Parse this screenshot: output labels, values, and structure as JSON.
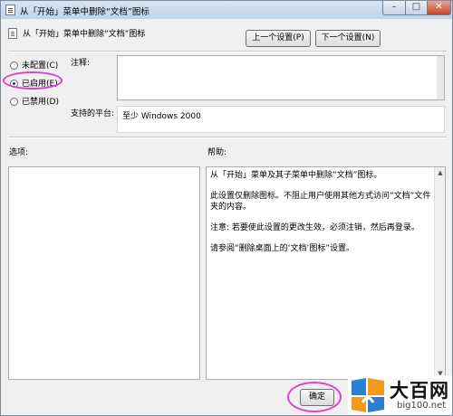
{
  "window": {
    "title": "从「开始」菜单中删除“文档”图标",
    "minimize_symbol": "–",
    "maximize_symbol": "□",
    "close_symbol": "✕"
  },
  "header": {
    "policy_title": "从「开始」菜单中删除“文档”图标",
    "prev_button": "上一个设置(P)",
    "next_button": "下一个设置(N)"
  },
  "state": {
    "options": [
      {
        "label": "未配置(C)",
        "checked": false
      },
      {
        "label": "已启用(E)",
        "checked": true
      },
      {
        "label": "已禁用(D)",
        "checked": false
      }
    ]
  },
  "comment": {
    "label": "注释:",
    "value": ""
  },
  "platform": {
    "label": "支持的平台:",
    "value": "至少 Windows 2000"
  },
  "options_panel": {
    "label": "选项:"
  },
  "help_panel": {
    "label": "帮助:",
    "paragraphs": [
      "从「开始」菜单及其子菜单中删除“文档”图标。",
      "此设置仅删除图标。不阻止用户使用其他方式访问“文档”文件夹的内容。",
      "注意: 若要使此设置的更改生效，必须注销，然后再登录。",
      "请参阅“删除桌面上的‘文档’图标”设置。"
    ]
  },
  "footer": {
    "ok_button": "确定"
  },
  "watermark": {
    "name": "大百网",
    "url": "big100.net"
  },
  "colors": {
    "highlight_ellipse": "#e23fd0",
    "watermark_blue": "#2a7fd4",
    "watermark_orange": "#f39a1e"
  }
}
